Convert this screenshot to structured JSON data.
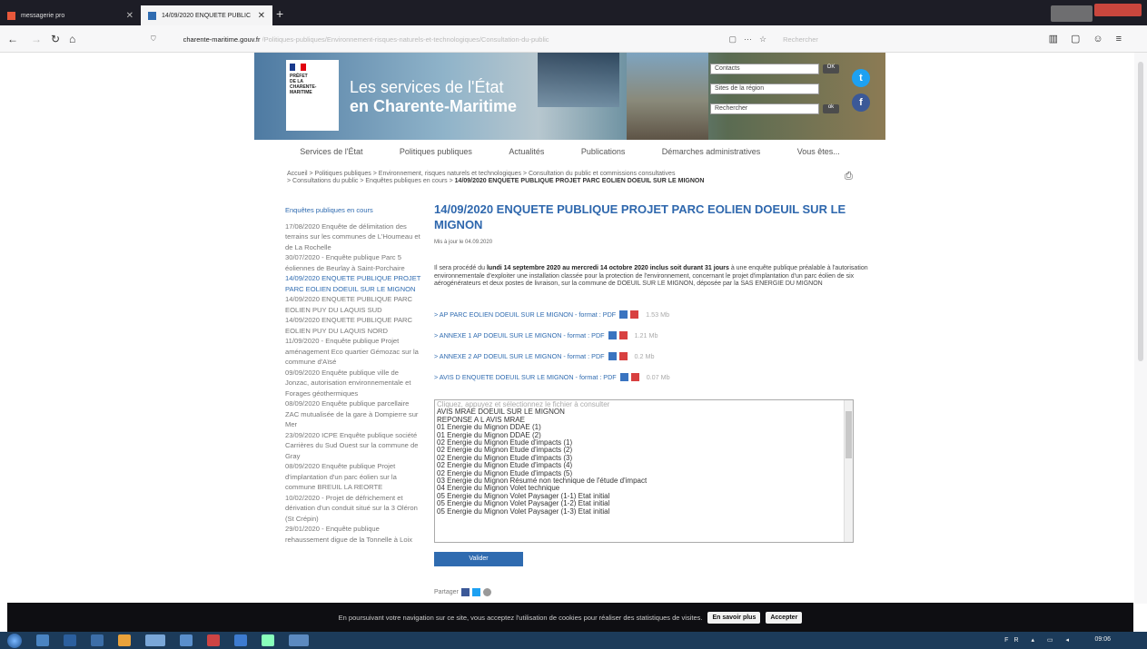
{
  "browser": {
    "tabs": [
      {
        "label": "messagerie pro",
        "active": false
      },
      {
        "label": "14/09/2020 ENQUETE PUBLIC",
        "active": true
      }
    ],
    "url_domain": "charente-maritime.gouv.fr",
    "url_path": "/Politiques-publiques/Environnement-risques-naturels-et-technologiques/Consultation-du-public",
    "search_placeholder": "Rechercher"
  },
  "site": {
    "logo_lines": [
      "PRÉFET",
      "DE LA",
      "CHARENTE-",
      "MARITIME"
    ],
    "title_line1": "Les services de l'État",
    "title_line2": "en Charente-Maritime",
    "tools": {
      "contacts": "Contacts",
      "sites": "Sites de la région",
      "search": "Rechercher"
    },
    "menu": [
      "Services de l'État",
      "Politiques publiques",
      "Actualités",
      "Publications",
      "Démarches administratives",
      "Vous êtes..."
    ]
  },
  "breadcrumb": {
    "line1": "Accueil > Politiques publiques > Environnement, risques naturels et technologiques > Consultation du public et commissions consultatives",
    "line2": "> Consultations du public > Enquêtes publiques en cours > ",
    "current": "14/09/2020 ENQUETE PUBLIQUE PROJET PARC EOLIEN DOEUIL SUR LE MIGNON"
  },
  "sidebar": {
    "heading": "Enquêtes publiques en cours",
    "items": [
      "17/08/2020 Enquête de délimitation des terrains sur les communes de L'Houmeau et de La Rochelle",
      "30/07/2020 - Enquête publique Parc 5 éoliennes de Beurlay à Saint-Porchaire",
      "14/09/2020 ENQUETE PUBLIQUE PROJET PARC EOLIEN DOEUIL SUR LE MIGNON",
      "14/09/2020 ENQUETE PUBLIQUE PARC EOLIEN PUY DU LAQUIS SUD",
      "14/09/2020 ENQUETE PUBLIQUE PARC EOLIEN PUY DU LAQUIS NORD",
      "11/09/2020 - Enquête publique Projet aménagement Eco quartier Gémozac sur la commune d'Aïsé",
      "09/09/2020 Enquête publique ville de Jonzac, autorisation environnementale et Forages géothermiques",
      "08/09/2020 Enquête publique parcellaire ZAC mutualisée de la gare à Dompierre sur Mer",
      "23/09/2020 ICPE Enquête publique société Carrières du Sud Ouest sur la commune de Gray",
      "08/09/2020 Enquête publique Projet d'implantation d'un parc éolien sur la commune BREUIL LA REORTE",
      "10/02/2020 - Projet de défrichement et dérivation d'un conduit situé sur la 3 Oléron (St Crépin)",
      "29/01/2020 - Enquête publique rehaussement digue de la Tonnelle à Loix"
    ],
    "active_index": 2
  },
  "article": {
    "title": "14/09/2020 ENQUETE PUBLIQUE PROJET PARC EOLIEN DOEUIL SUR LE MIGNON",
    "date": "Mis à jour le 04.09.2020",
    "intro_before": "Il sera procédé du ",
    "intro_bold": "lundi 14 septembre 2020 au mercredi 14 octobre 2020 inclus soit durant 31 jours",
    "intro_after": " à une enquête publique préalable à l'autorisation environnementale d'exploiter une installation classée pour la protection de l'environnement, concernant le projet d'implantation d'un parc éolien de six aérogénérateurs et deux postes de livraison, sur la commune de DOEUIL SUR LE MIGNON, déposée par la SAS ENERGIE DU MIGNON",
    "downloads": [
      {
        "label": "> AP PARC EOLIEN DOEUIL SUR LE MIGNON - format : PDF",
        "size": "1.53 Mb"
      },
      {
        "label": "> ANNEXE 1 AP DOEUIL SUR LE MIGNON - format : PDF",
        "size": "1.21 Mb"
      },
      {
        "label": "> ANNEXE 2 AP DOEUIL SUR LE MIGNON - format : PDF",
        "size": "0.2 Mb"
      },
      {
        "label": "> AVIS D ENQUETE DOEUIL SUR LE MIGNON - format : PDF",
        "size": "0.07 Mb"
      }
    ],
    "file_list": [
      "Cliquez, appuyez et sélectionnez le fichier à consulter",
      "AVIS MRAE DOEUIL SUR LE MIGNON",
      "REPONSE A L AVIS MRAE",
      "01 Energie du Mignon DDAE (1)",
      "01 Energie du Mignon DDAE (2)",
      "02 Energie du Mignon Etude d'impacts (1)",
      "02 Energie du Mignon Etude d'impacts (2)",
      "02 Energie du Mignon Etude d'impacts (3)",
      "02 Energie du Mignon Etude d'impacts (4)",
      "02 Energie du Mignon Etude d'impacts (5)",
      "03 Energie du Mignon Résumé non technique de l'étude d'impact",
      "04 Energie du Mignon Volet technique",
      "05 Energie du Mignon Volet Paysager (1-1) Etat initial",
      "05 Energie du Mignon Volet Paysager (1-2) Etat initial",
      "05 Energie du Mignon Volet Paysager (1-3) Etat initial"
    ],
    "valider": "Valider",
    "share": "Partager"
  },
  "cookie": {
    "text": "En poursuivant votre navigation sur ce site, vous acceptez l'utilisation de cookies pour réaliser des statistiques de visites.",
    "more": "En savoir plus",
    "accept": "Accepter"
  },
  "taskbar": {
    "lang": "FR",
    "time": "09:06"
  },
  "colors": {
    "accent": "#2f6bb0",
    "tabbar": "#1d1d26",
    "cookie_bg": "#0e0e12"
  }
}
